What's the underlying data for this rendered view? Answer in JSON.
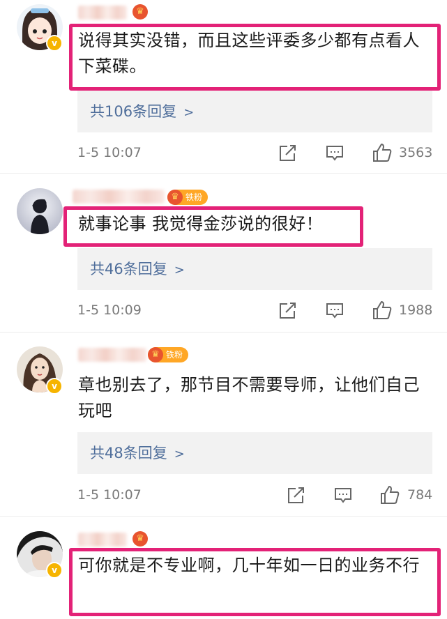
{
  "comments": [
    {
      "text": "说得其实没错，而且这些评委多少都有点看人下菜碟。",
      "replies": "共106条回复",
      "time": "1-5 10:07",
      "likes": "3563",
      "highlighted": true,
      "fan_badge": ""
    },
    {
      "text": "就事论事 我觉得金莎说的很好！",
      "replies": "共46条回复",
      "time": "1-5 10:09",
      "likes": "1988",
      "highlighted": true,
      "fan_badge": "铁粉"
    },
    {
      "text": "章也别去了，那节目不需要导师，让他们自己玩吧",
      "replies": "共48条回复",
      "time": "1-5 10:07",
      "likes": "784",
      "highlighted": false,
      "fan_badge": "铁粉"
    },
    {
      "text": "可你就是不专业啊，几十年如一日的业务不行",
      "replies": "",
      "time": "",
      "likes": "",
      "highlighted": true,
      "fan_badge": ""
    }
  ],
  "colors": {
    "highlight": "#e32277",
    "reply_link": "#4f6e9b",
    "meta": "#7a7a7a",
    "verified": "#f6b400"
  },
  "icons": {
    "repost": "share-icon",
    "comment": "comment-icon",
    "like": "thumbs-up-icon"
  }
}
